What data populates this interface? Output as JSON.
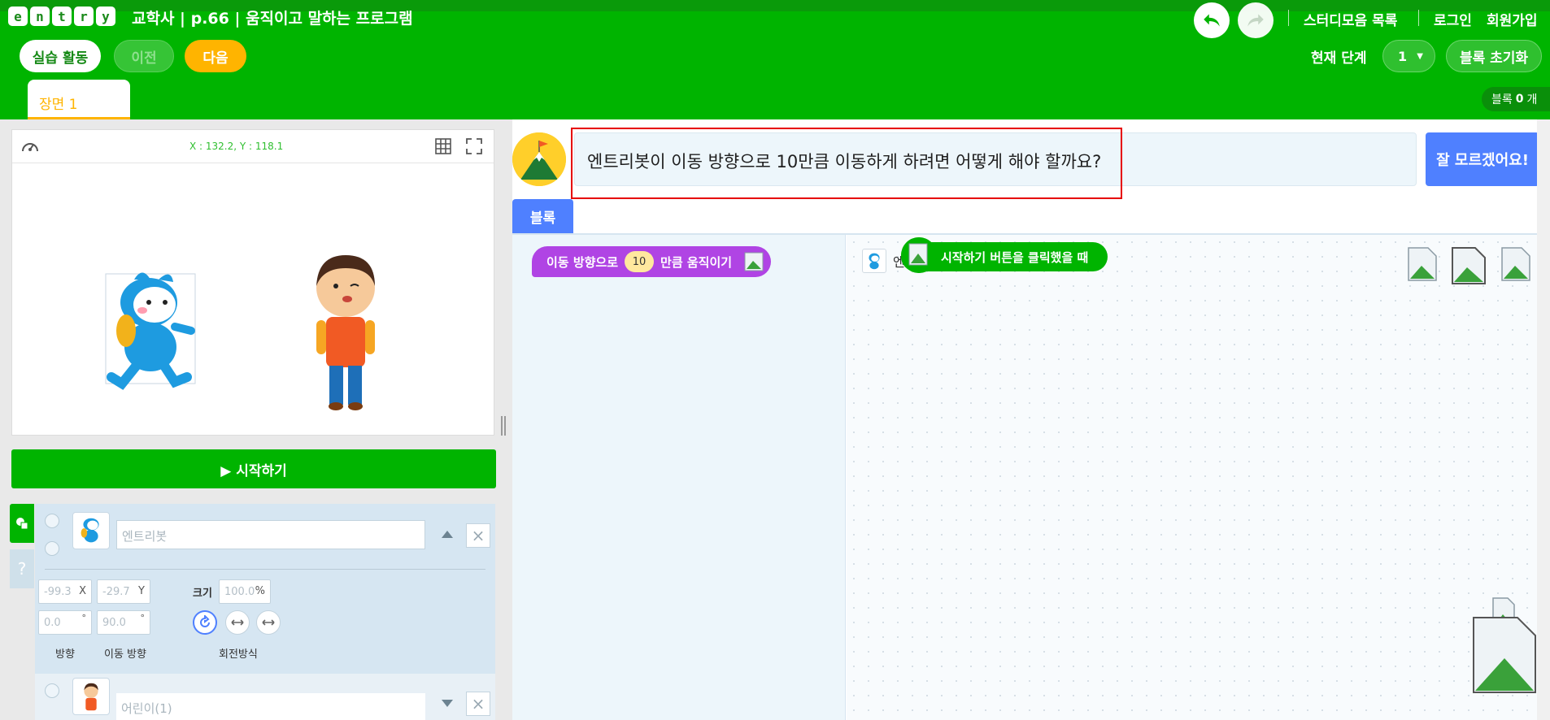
{
  "app": {
    "logo_letters": [
      "e",
      "n",
      "t",
      "r",
      "y"
    ],
    "title": "교학사 | p.66 | 움직이고 말하는 프로그램"
  },
  "nav": {
    "studies": "스터디모음 목록",
    "login": "로그인",
    "signup": "회원가입"
  },
  "toolbar": {
    "practice": "실습 활동",
    "prev": "이전",
    "next": "다음",
    "stage_label": "현재 단계",
    "stage_value": "1",
    "reset": "블록 초기화"
  },
  "scene": {
    "tab": "장면 1"
  },
  "block_count": {
    "label": "블록",
    "value": "0",
    "unit": "개"
  },
  "stage": {
    "coords": "X : 132.2, Y : 118.1"
  },
  "start_button": "▶ 시작하기",
  "object": {
    "name_placeholder": "엔트리봇",
    "x_value": "-99.3",
    "x_suffix": "X",
    "y_value": "-29.7",
    "y_suffix": "Y",
    "size_label": "크기",
    "size_value": "100.0",
    "size_suffix": "%",
    "direction_value": "0.0",
    "move_direction_value": "90.0",
    "degree": "°",
    "labels": {
      "direction": "방향",
      "move_direction": "이동 방향",
      "rotation": "회전방식"
    }
  },
  "object2": {
    "name_placeholder": "어린이(1)"
  },
  "side_tabs": {
    "help": "?"
  },
  "mission": {
    "text": "엔트리봇이 이동 방향으로 10만큼 이동하게 하려면 어떻게 해야 할까요?",
    "help_button": "잘 모르겠어요!"
  },
  "palette": {
    "tab": "블록",
    "move_block": {
      "prefix": "이동 방향으로",
      "value": "10",
      "suffix": "만큼 움직이기"
    }
  },
  "workspace": {
    "obj_letter": "엔",
    "start_block": "시작하기 버튼을 클릭했을 때"
  },
  "colors": {
    "header": "#00b400",
    "accent_yellow": "#ffb400",
    "accent_blue": "#4f80ff",
    "move_block": "#b044e4",
    "highlight": "#e60000"
  }
}
